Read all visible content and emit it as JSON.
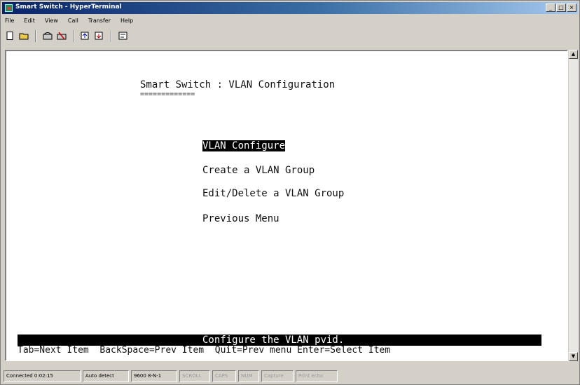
{
  "window": {
    "title": "Smart Switch - HyperTerminal",
    "controls": [
      "_",
      "□",
      "×"
    ]
  },
  "menubar": [
    "File",
    "Edit",
    "View",
    "Call",
    "Transfer",
    "Help"
  ],
  "toolbar": {
    "icons": [
      "new-icon",
      "open-icon",
      "call-icon",
      "disconnect-icon",
      "send-icon",
      "receive-icon",
      "properties-icon"
    ]
  },
  "terminal": {
    "title": "Smart Switch : VLAN Configuration",
    "title_underline": "=============",
    "menu_items": [
      "VLAN Configure",
      "Create a VLAN Group",
      "Edit/Delete a VLAN Group",
      "Previous Menu"
    ],
    "selected_index": 0,
    "hint": "Configure the VLAN pvid.",
    "key_help": "Tab=Next Item  BackSpace=Prev Item  Quit=Prev menu Enter=Select Item"
  },
  "statusbar": {
    "panels": [
      "Connected 0:02:15",
      "Auto detect",
      "9600 8-N-1",
      "SCROLL",
      "CAPS",
      "NUM",
      "Capture",
      "Print echo"
    ],
    "dim_from_index": 3
  },
  "colors": {
    "titlebar_start": "#0a246a",
    "titlebar_end": "#a6caf0",
    "terminal_bg": "#ffffff",
    "highlight_bg": "#000000",
    "highlight_fg": "#ffffff"
  }
}
